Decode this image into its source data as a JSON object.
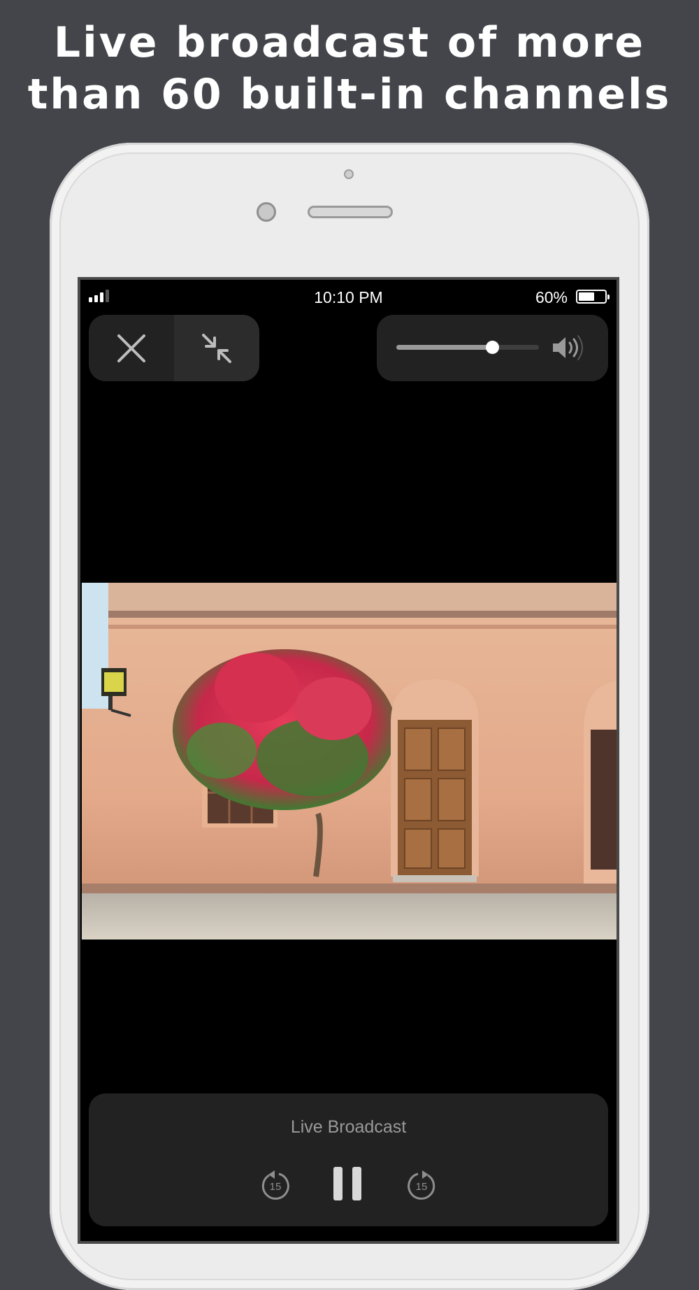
{
  "headline": {
    "line1": "Live broadcast of more",
    "line2": "than 60 built-in channels"
  },
  "status_bar": {
    "time": "10:10 PM",
    "battery": "60%",
    "battery_level": 0.6,
    "signal_bars": 3
  },
  "controls": {
    "close_icon": "close-icon",
    "minimize_icon": "exit-fullscreen-icon",
    "volume_level": 0.67,
    "volume_icon": "speaker-volume-icon"
  },
  "player": {
    "title": "Live Broadcast",
    "skip_back_label": "15",
    "skip_forward_label": "15",
    "pause_icon": "pause-icon"
  },
  "colors": {
    "page_bg": "#44454a",
    "screen_bg": "#000000",
    "panel_bg": "#222222"
  }
}
